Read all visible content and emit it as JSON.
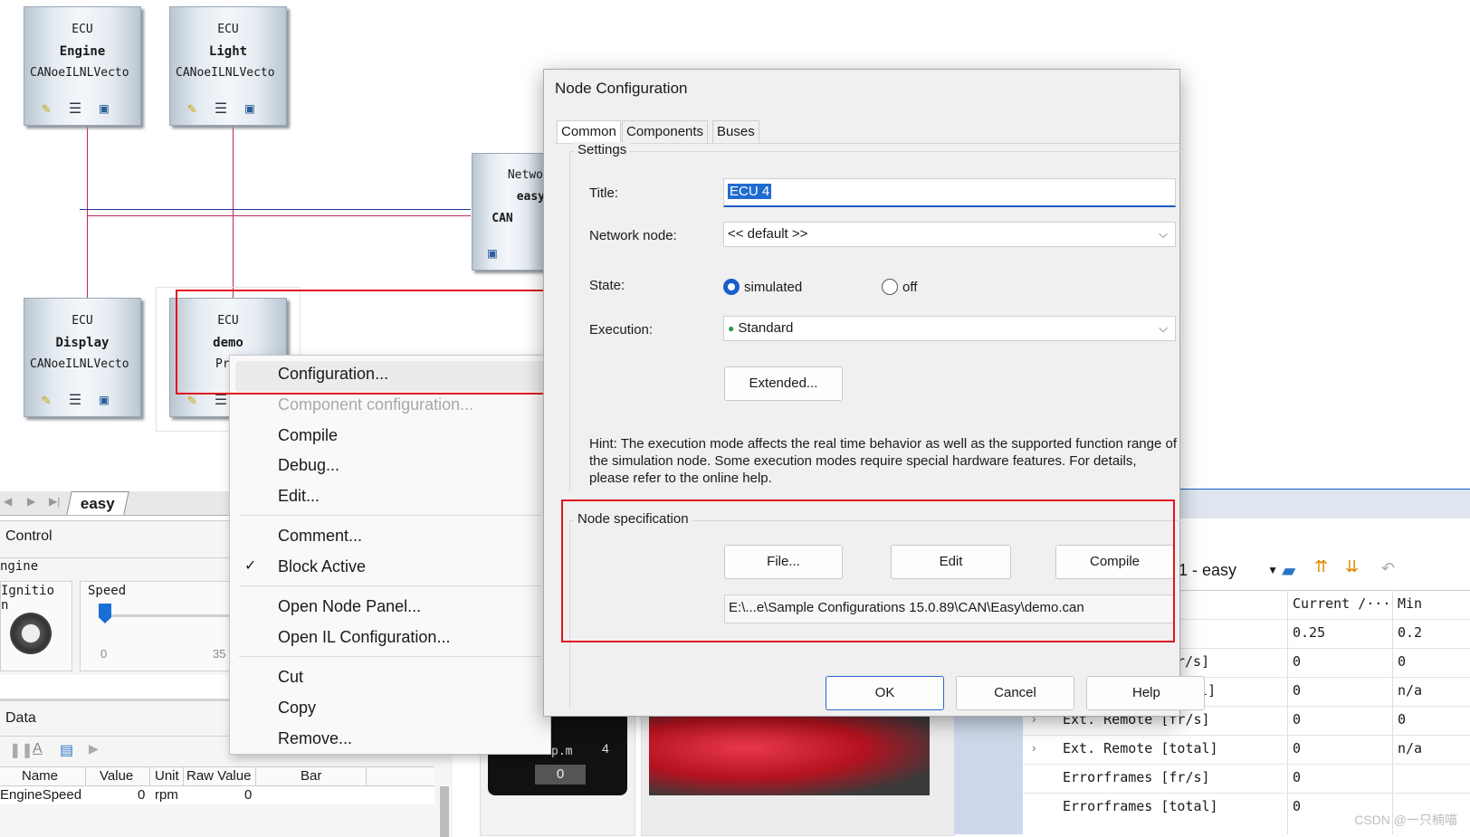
{
  "nodes": [
    {
      "line1": "ECU",
      "line2": "Engine",
      "line3": "CANoeILNLVecto"
    },
    {
      "line1": "ECU",
      "line2": "Light",
      "line3": "CANoeILNLVecto"
    },
    {
      "line1": "ECU",
      "line2": "Display",
      "line3": "CANoeILNLVecto"
    },
    {
      "line1": "ECU",
      "line2": "demo",
      "line3": "Pr"
    }
  ],
  "network_node": {
    "line1": "Netwo",
    "line2": "easy",
    "line3": "CAN"
  },
  "bottom_left": {
    "tab": "easy",
    "control_title": "Control",
    "engine_label": "ngine",
    "ignition_label": "Ignitio",
    "ignition_label2": "n",
    "speed_label": "Speed",
    "speed_min": "0",
    "speed_tick": "35",
    "data_title": "Data",
    "table_headers": [
      "Name",
      "Value",
      "Unit",
      "Raw Value",
      "Bar"
    ],
    "table_row": [
      "EngineSpeed",
      "0",
      "rpm",
      "0",
      ""
    ]
  },
  "gauge": {
    "unit_text": "p.m",
    "tick": "4",
    "readout": "0"
  },
  "context_menu": {
    "items": [
      {
        "label": "Configuration...",
        "disabled": false
      },
      {
        "label": "Component configuration...",
        "disabled": true
      },
      {
        "label": "Compile",
        "disabled": false
      },
      {
        "label": "Debug...",
        "disabled": false
      },
      {
        "label": "Edit...",
        "disabled": false
      },
      {
        "label": "Comment...",
        "disabled": false
      },
      {
        "label": "Block Active",
        "disabled": false,
        "checked": true
      },
      {
        "label": "Open Node Panel...",
        "disabled": false
      },
      {
        "label": "Open IL Configuration...",
        "disabled": false
      },
      {
        "label": "Cut",
        "disabled": false
      },
      {
        "label": "Copy",
        "disabled": false
      },
      {
        "label": "Remove...",
        "disabled": false
      }
    ]
  },
  "dialog": {
    "title": "Node Configuration",
    "tabs": [
      "Common",
      "Components",
      "Buses"
    ],
    "settings_label": "Settings",
    "title_label": "Title:",
    "title_value": "ECU 4",
    "network_node_label": "Network node:",
    "network_node_value": "<< default >>",
    "state_label": "State:",
    "state_simulated": "simulated",
    "state_off": "off",
    "execution_label": "Execution:",
    "execution_value": "Standard",
    "extended_button": "Extended...",
    "hint": "Hint: The execution mode affects the real time behavior as well as the supported function range of the simulation node. Some execution modes require special hardware features. For details, please refer to the online help.",
    "node_spec_label": "Node specification",
    "file_button": "File...",
    "edit_button": "Edit",
    "compile_button": "Compile",
    "file_path": "E:\\...e\\Sample Configurations 15.0.89\\CAN\\Easy\\demo.can",
    "ok_button": "OK",
    "cancel_button": "Cancel",
    "help_button": "Help"
  },
  "right_panel": {
    "dropdown": "1 - easy",
    "header_current": "Current /···",
    "header_min": "Min",
    "rows": [
      {
        "name": "",
        "current": "0.25",
        "min": "0.2"
      },
      {
        "name": "r/s]",
        "current": "0",
        "min": "0"
      },
      {
        "name": "otal]",
        "current": "0",
        "min": "n/a"
      },
      {
        "name": "Ext. Remote [fr/s]",
        "current": "0",
        "min": "0"
      },
      {
        "name": "Ext. Remote [total]",
        "current": "0",
        "min": "n/a"
      },
      {
        "name": "Errorframes [fr/s]",
        "current": "0",
        "min": ""
      },
      {
        "name": "Errorframes [total]",
        "current": "0",
        "min": ""
      }
    ]
  },
  "watermark": "CSDN @一只楠喵"
}
